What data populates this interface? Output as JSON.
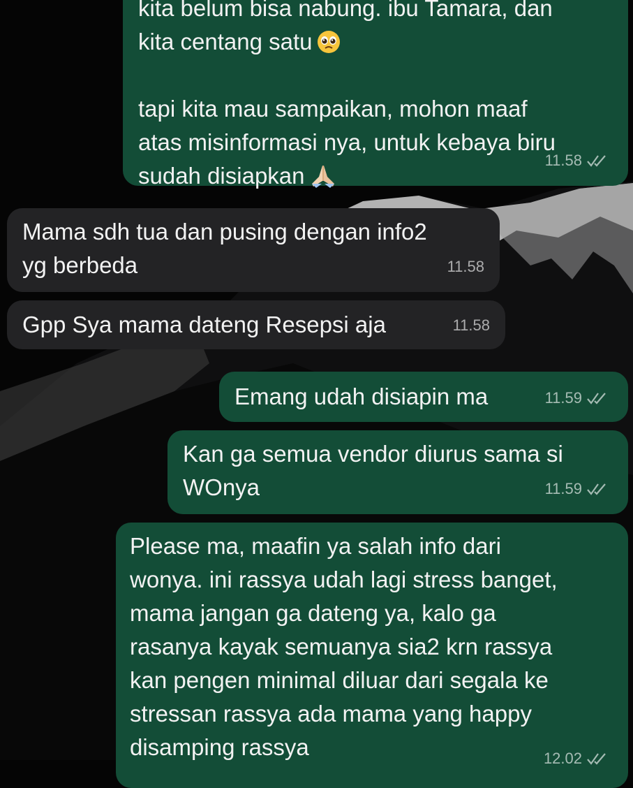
{
  "chat": {
    "messages": [
      {
        "direction": "outgoing",
        "lines": [
          "kita belum bisa nabung. ibu Tamara, dan",
          "kita centang satu",
          "",
          "tapi kita mau sampaikan, mohon maaf",
          "atas misinformasi nya, untuk kebaya biru",
          "sudah disiapkan"
        ],
        "time": "11.58",
        "status": "read",
        "emoji": [
          "pleading-face",
          "folded-hands"
        ]
      },
      {
        "direction": "incoming",
        "lines": [
          "Mama sdh tua dan pusing dengan info2",
          "yg berbeda"
        ],
        "time": "11.58"
      },
      {
        "direction": "incoming",
        "lines": [
          "Gpp Sya mama dateng Resepsi aja"
        ],
        "time": "11.58"
      },
      {
        "direction": "outgoing",
        "lines": [
          "Emang udah disiapin ma"
        ],
        "time": "11.59",
        "status": "read"
      },
      {
        "direction": "outgoing",
        "lines": [
          "Kan ga semua vendor diurus sama si",
          "WOnya"
        ],
        "time": "11.59",
        "status": "read"
      },
      {
        "direction": "outgoing",
        "lines": [
          "Please ma, maafin ya salah info dari",
          "wonya. ini rassya udah lagi stress banget,",
          "mama jangan ga dateng ya, kalo ga",
          "rasanya kayak semuanya sia2 krn rassya",
          "kan pengen minimal diluar dari segala ke",
          "stressan rassya ada mama yang happy",
          "disamping rassya"
        ],
        "time": "12.02",
        "status": "read"
      }
    ]
  },
  "colors": {
    "outgoing_bubble": "#134d37",
    "incoming_bubble": "#232325",
    "background": "#050505",
    "text": "#f2f2f2"
  }
}
